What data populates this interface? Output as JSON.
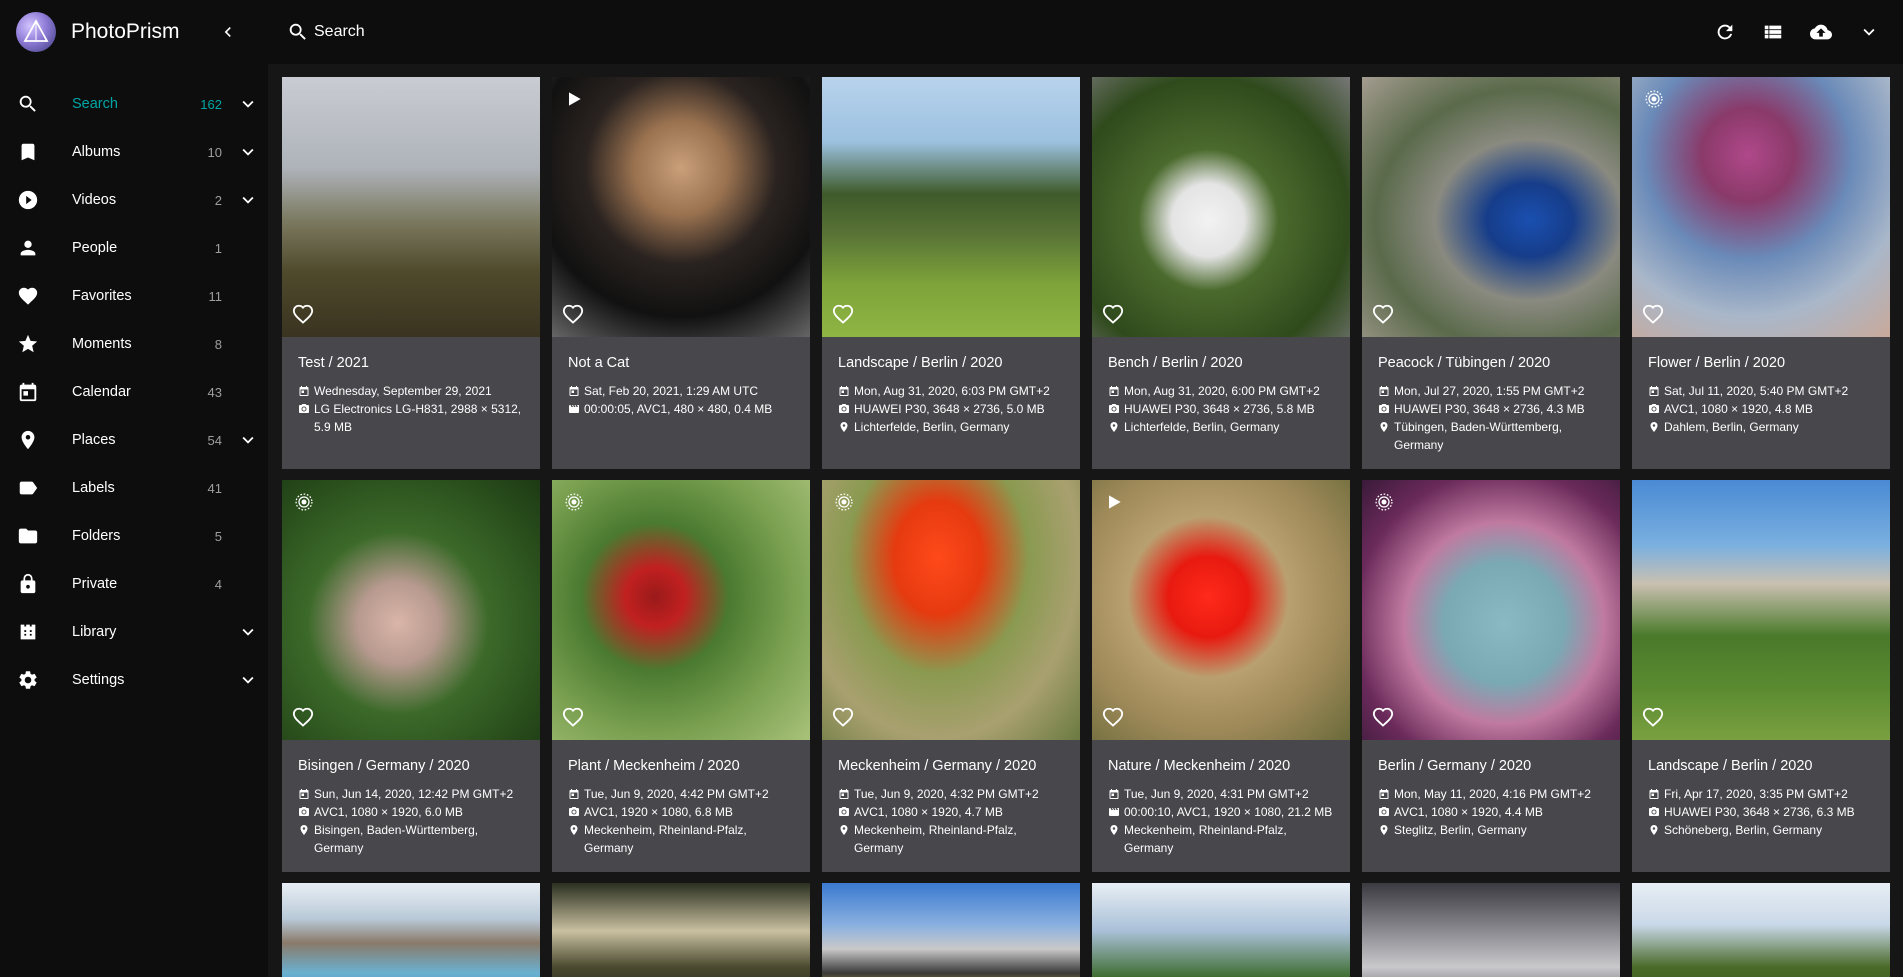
{
  "app": {
    "name": "PhotoPrism"
  },
  "sidebar": {
    "items": [
      {
        "key": "search",
        "label": "Search",
        "count": "162",
        "icon": "search-icon",
        "expand": true,
        "active": true
      },
      {
        "key": "albums",
        "label": "Albums",
        "count": "10",
        "icon": "bookmark-icon",
        "expand": true
      },
      {
        "key": "videos",
        "label": "Videos",
        "count": "2",
        "icon": "play-circle-icon",
        "expand": true
      },
      {
        "key": "people",
        "label": "People",
        "count": "1",
        "icon": "person-icon",
        "expand": false
      },
      {
        "key": "favorites",
        "label": "Favorites",
        "count": "11",
        "icon": "heart-icon",
        "expand": false
      },
      {
        "key": "moments",
        "label": "Moments",
        "count": "8",
        "icon": "star-icon",
        "expand": false
      },
      {
        "key": "calendar",
        "label": "Calendar",
        "count": "43",
        "icon": "calendar-icon",
        "expand": false
      },
      {
        "key": "places",
        "label": "Places",
        "count": "54",
        "icon": "place-icon",
        "expand": true
      },
      {
        "key": "labels",
        "label": "Labels",
        "count": "41",
        "icon": "label-icon",
        "expand": false
      },
      {
        "key": "folders",
        "label": "Folders",
        "count": "5",
        "icon": "folder-icon",
        "expand": false
      },
      {
        "key": "private",
        "label": "Private",
        "count": "4",
        "icon": "lock-icon",
        "expand": false
      },
      {
        "key": "library",
        "label": "Library",
        "count": "",
        "icon": "library-icon",
        "expand": true
      },
      {
        "key": "settings",
        "label": "Settings",
        "count": "",
        "icon": "gear-icon",
        "expand": true
      }
    ]
  },
  "search": {
    "placeholder": "Search"
  },
  "photos": [
    {
      "title": "Test / 2021",
      "date": "Wednesday, September 29, 2021",
      "camera": "LG Electronics LG-H831, 2988 × 5312, 5.9 MB",
      "camera_icon": "camera-icon",
      "location": "",
      "badge": "",
      "bg": "linear-gradient(180deg,#c9ccd2 0%,#aeb3ba 35%,#7c7a61 55%,#4f4a2c 75%,#3a3320 100%)"
    },
    {
      "title": "Not a Cat",
      "date": "Sat, Feb 20, 2021, 1:29 AM UTC",
      "camera": "00:00:05, AVC1, 480 × 480, 0.4 MB",
      "camera_icon": "film-icon",
      "location": "",
      "badge": "play-icon",
      "bg": "radial-gradient(circle at 50% 35%,#c9a07a 0%,#9a7250 22%,#2a2320 45%,#111 70%,#666 100%)"
    },
    {
      "title": "Landscape / Berlin / 2020",
      "date": "Mon, Aug 31, 2020, 6:03 PM GMT+2",
      "camera": "HUAWEI P30, 3648 × 2736, 5.0 MB",
      "camera_icon": "camera-icon",
      "location": "Lichterfelde, Berlin, Germany",
      "badge": "",
      "bg": "linear-gradient(180deg,#b9d3ec 0%,#9cc1e0 25%,#3f5a2a 45%,#587236 60%,#7ea43a 80%,#8fb544 100%)"
    },
    {
      "title": "Bench / Berlin / 2020",
      "date": "Mon, Aug 31, 2020, 6:00 PM GMT+2",
      "camera": "HUAWEI P30, 3648 × 2736, 5.8 MB",
      "camera_icon": "camera-icon",
      "location": "Lichterfelde, Berlin, Germany",
      "badge": "",
      "bg": "radial-gradient(ellipse at 45% 55%,#f2f2f2 0%,#e4e4e4 18%,#4b6a2d 35%,#2f4a1c 70%,#777 100%)"
    },
    {
      "title": "Peacock / Tübingen / 2020",
      "date": "Mon, Jul 27, 2020, 1:55 PM GMT+2",
      "camera": "HUAWEI P30, 3648 × 2736, 4.3 MB",
      "camera_icon": "camera-icon",
      "location": "Tübingen, Baden-Württemberg, Germany",
      "badge": "",
      "bg": "radial-gradient(ellipse at 65% 55%,#1a4fb0 0%,#163d8a 18%,#8a8a80 40%,#5a6a4a 65%,#a49c90 100%)"
    },
    {
      "title": "Flower / Berlin / 2020",
      "date": "Sat, Jul 11, 2020, 5:40 PM GMT+2",
      "camera": "AVC1, 1080 × 1920, 4.8 MB",
      "camera_icon": "camera-icon",
      "location": "Dahlem, Berlin, Germany",
      "badge": "live-icon",
      "bg": "radial-gradient(circle at 45% 30%,#b0488a 0%,#8a3a6a 20%,#6a8ab8 45%,#a9b7c9 70%,#c9a99a 100%)"
    },
    {
      "title": "Bisingen / Germany / 2020",
      "date": "Sun, Jun 14, 2020, 12:42 PM GMT+2",
      "camera": "AVC1, 1080 × 1920, 6.0 MB",
      "camera_icon": "camera-icon",
      "location": "Bisingen, Baden-Württemberg, Germany",
      "badge": "live-icon",
      "bg": "radial-gradient(ellipse at 45% 55%,#d9b5a8 0%,#b89a90 20%,#3c6a2a 45%,#2a4f1c 75%,#1d3a14 100%)"
    },
    {
      "title": "Plant / Meckenheim / 2020",
      "date": "Tue, Jun 9, 2020, 4:42 PM GMT+2",
      "camera": "AVC1, 1920 × 1080, 6.8 MB",
      "camera_icon": "camera-icon",
      "location": "Meckenheim, Rheinland-Pfalz, Germany",
      "badge": "live-icon",
      "bg": "radial-gradient(circle at 40% 45%,#9a1a1a 0%,#c12020 14%,#4a7a30 35%,#7aa050 65%,#a9c27a 100%)"
    },
    {
      "title": "Meckenheim / Germany / 2020",
      "date": "Tue, Jun 9, 2020, 4:32 PM GMT+2",
      "camera": "AVC1, 1080 × 1920, 4.7 MB",
      "camera_icon": "camera-icon",
      "location": "Meckenheim, Rheinland-Pfalz, Germany",
      "badge": "live-icon",
      "bg": "radial-gradient(ellipse at 45% 30%,#ff4a1a 0%,#e63a10 22%,#8a9a50 45%,#a9a070 70%,#6a7a40 100%)"
    },
    {
      "title": "Nature / Meckenheim / 2020",
      "date": "Tue, Jun 9, 2020, 4:31 PM GMT+2",
      "camera": "00:00:10, AVC1, 1920 × 1080, 21.2 MB",
      "camera_icon": "film-icon",
      "location": "Meckenheim, Rheinland-Pfalz, Germany",
      "badge": "play-icon",
      "bg": "radial-gradient(circle at 45% 45%,#ff2a1a 0%,#e81a10 20%,#b9a070 40%,#a08a5a 65%,#6a6a3a 100%)"
    },
    {
      "title": "Berlin / Germany / 2020",
      "date": "Mon, May 11, 2020, 4:16 PM GMT+2",
      "camera": "AVC1, 1080 × 1920, 4.4 MB",
      "camera_icon": "camera-icon",
      "location": "Steglitz, Berlin, Germany",
      "badge": "live-icon",
      "bg": "radial-gradient(ellipse at 55% 55%,#8ab9c4 0%,#7aa9b4 30%,#c07aa0 50%,#6a2a5a 75%,#3a1a3a 100%)"
    },
    {
      "title": "Landscape / Berlin / 2020",
      "date": "Fri, Apr 17, 2020, 3:35 PM GMT+2",
      "camera": "HUAWEI P30, 3648 × 2736, 6.3 MB",
      "camera_icon": "camera-icon",
      "location": "Schöneberg, Berlin, Germany",
      "badge": "",
      "bg": "linear-gradient(180deg,#4a8ad4 0%,#7ab0e0 25%,#c9c0b0 40%,#4a7a2a 60%,#5a8a30 80%,#7aa040 100%)"
    },
    {
      "title": "",
      "date": "",
      "camera": "",
      "camera_icon": "",
      "location": "",
      "badge": "",
      "bg": "linear-gradient(180deg,#e8eef4 0%,#b9c9d8 30%,#8a7a6a 50%,#6ab0d0 75%,#2a8ab8 100%)"
    },
    {
      "title": "",
      "date": "",
      "camera": "",
      "camera_icon": "",
      "location": "",
      "badge": "",
      "bg": "linear-gradient(180deg,#2a3020 0%,#c9c0a0 40%,#4a4a30 70%,#2a2a1a 100%)"
    },
    {
      "title": "",
      "date": "",
      "camera": "",
      "camera_icon": "",
      "location": "",
      "badge": "",
      "bg": "linear-gradient(180deg,#3a7ad0 0%,#8ab0e0 35%,#c9c9c9 55%,#3a3a3a 75%,#e0c020 100%)"
    },
    {
      "title": "",
      "date": "",
      "camera": "",
      "camera_icon": "",
      "location": "",
      "badge": "",
      "bg": "linear-gradient(180deg,#e8eef4 0%,#a9c0d8 40%,#3a6a2a 80%,#2a4a1a 100%)"
    },
    {
      "title": "",
      "date": "",
      "camera": "",
      "camera_icon": "",
      "location": "",
      "badge": "",
      "bg": "linear-gradient(180deg,#3a3a40 0%,#8a8a90 40%,#c9c9cc 70%,#5a5a60 100%)"
    },
    {
      "title": "",
      "date": "",
      "camera": "",
      "camera_icon": "",
      "location": "",
      "badge": "",
      "bg": "linear-gradient(180deg,#e8eef4 0%,#c9d8e8 35%,#4a6a2a 70%,#3a5a1a 100%)"
    }
  ]
}
